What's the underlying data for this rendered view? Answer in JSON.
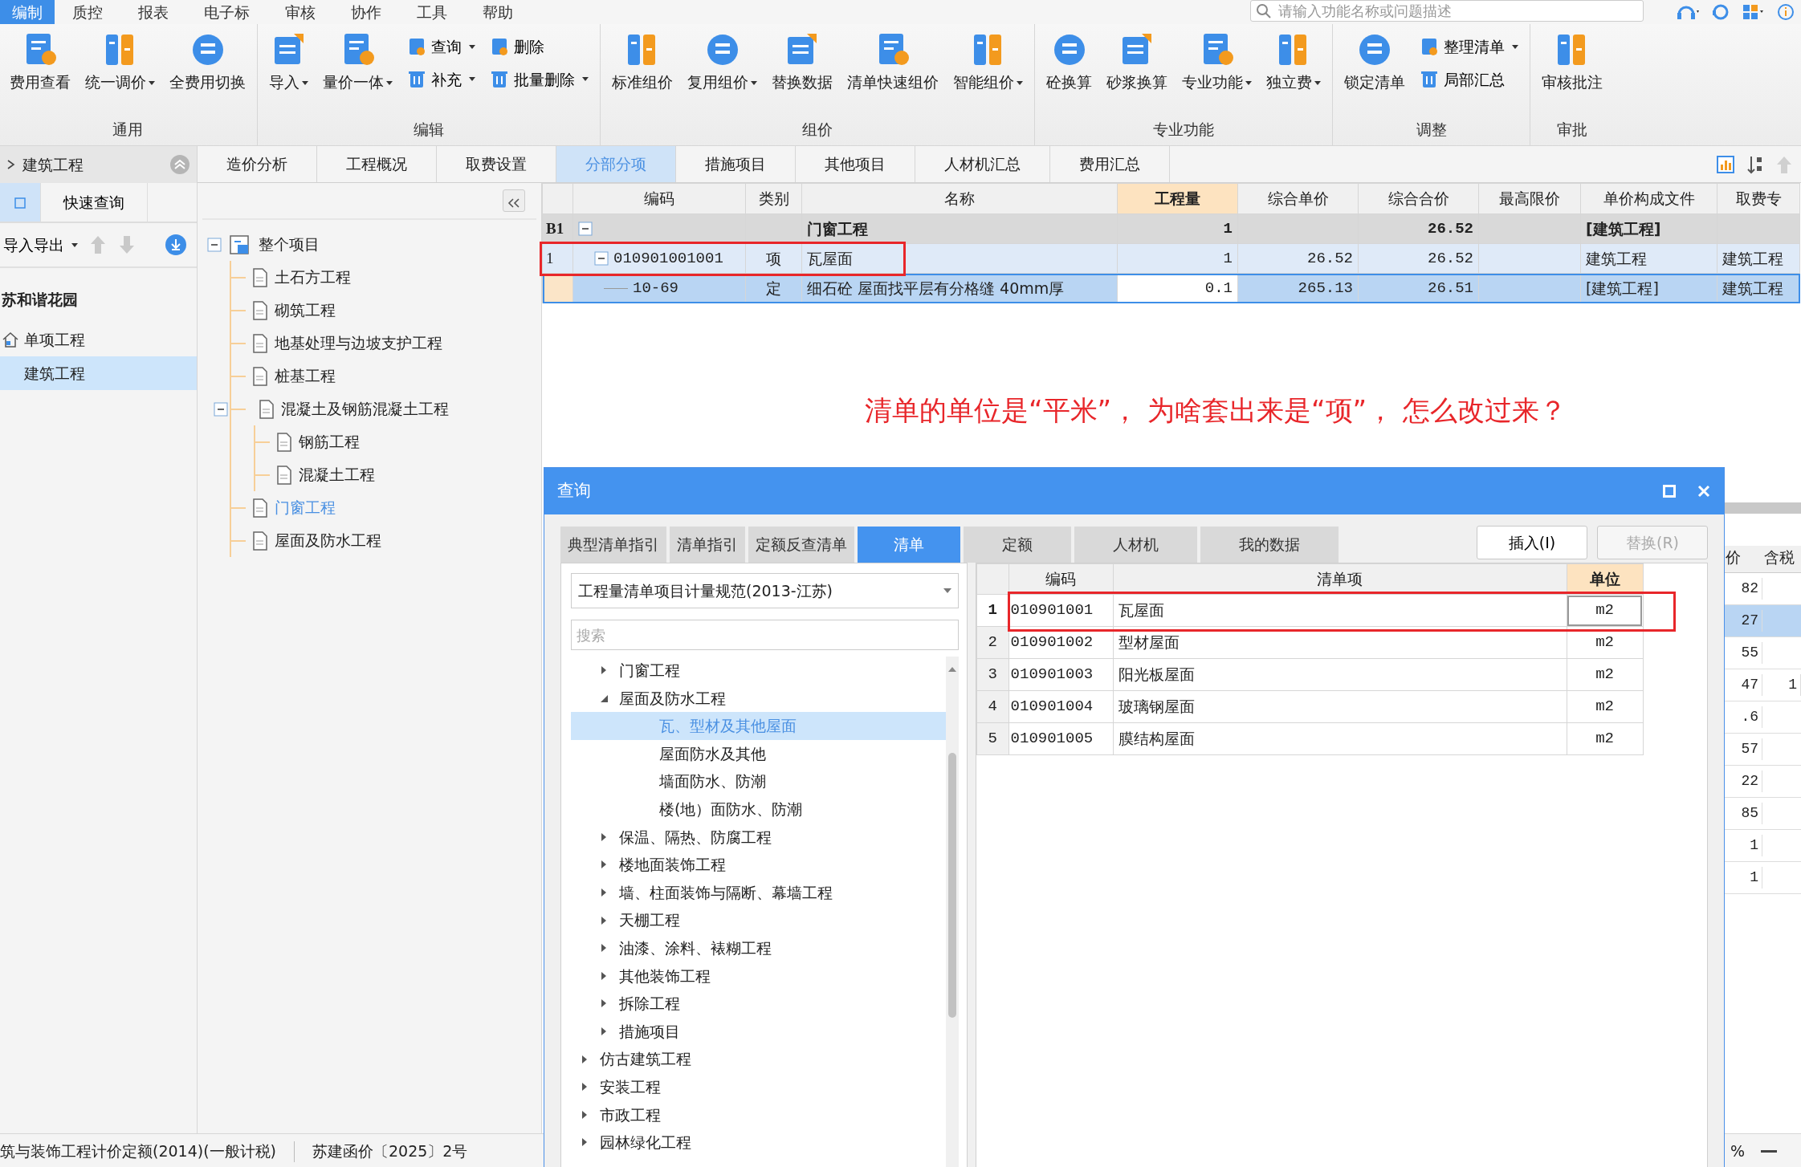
{
  "menu_bar": {
    "items": [
      {
        "label": "编制",
        "selected": true
      },
      {
        "label": "质控",
        "selected": false
      },
      {
        "label": "报表",
        "selected": false
      },
      {
        "label": "电子标",
        "selected": false
      },
      {
        "label": "审核",
        "selected": false
      },
      {
        "label": "协作",
        "selected": false
      },
      {
        "label": "工具",
        "selected": false
      },
      {
        "label": "帮助",
        "selected": false
      }
    ],
    "search": {
      "placeholder": "请输入功能名称或问题描述"
    }
  },
  "ribbon": {
    "groups": [
      {
        "label": "通用",
        "buttons": [
          {
            "label": "费用查看",
            "kind": "large",
            "dropdown": false
          },
          {
            "label": "统一调价",
            "kind": "large",
            "dropdown": true
          },
          {
            "label": "全费用切换",
            "kind": "large",
            "dropdown": false
          }
        ]
      },
      {
        "label": "编辑",
        "buttons": [
          {
            "label": "导入",
            "kind": "large",
            "dropdown": true
          },
          {
            "label": "量价一体",
            "kind": "large",
            "dropdown": true
          },
          {
            "label": "查询",
            "kind": "small",
            "dropdown": true
          },
          {
            "label": "补充",
            "kind": "small",
            "dropdown": true
          },
          {
            "label": "删除",
            "kind": "small",
            "dropdown": false
          },
          {
            "label": "批量删除",
            "kind": "small",
            "dropdown": true
          }
        ]
      },
      {
        "label": "组价",
        "buttons": [
          {
            "label": "标准组价",
            "kind": "large",
            "dropdown": false
          },
          {
            "label": "复用组价",
            "kind": "large",
            "dropdown": true
          },
          {
            "label": "替换数据",
            "kind": "large",
            "dropdown": false
          },
          {
            "label": "清单快速组价",
            "kind": "large",
            "dropdown": false
          },
          {
            "label": "智能组价",
            "kind": "large",
            "dropdown": true
          }
        ]
      },
      {
        "label": "专业功能",
        "buttons": [
          {
            "label": "砼换算",
            "kind": "large",
            "dropdown": false
          },
          {
            "label": "砂浆换算",
            "kind": "large",
            "dropdown": false
          },
          {
            "label": "专业功能",
            "kind": "large",
            "dropdown": true
          },
          {
            "label": "独立费",
            "kind": "large",
            "dropdown": true
          }
        ]
      },
      {
        "label": "调整",
        "buttons": [
          {
            "label": "锁定清单",
            "kind": "large",
            "dropdown": false
          },
          {
            "label": "整理清单",
            "kind": "small",
            "dropdown": true
          },
          {
            "label": "局部汇总",
            "kind": "small",
            "dropdown": false
          }
        ]
      },
      {
        "label": "审批",
        "buttons": [
          {
            "label": "审核批注",
            "kind": "large",
            "dropdown": false
          }
        ]
      }
    ]
  },
  "left_panel": {
    "title": "建筑工程",
    "tabs": [
      {
        "kind": "icon",
        "selected": true
      },
      {
        "kind": "text",
        "label": "快速查询",
        "selected": false
      }
    ],
    "toolbar": {
      "menu": "导入导出",
      "move_up_disabled": true,
      "move_down_disabled": true
    },
    "project": {
      "label": "苏和谐花园",
      "children": [
        {
          "label": "单项工程",
          "selected": false,
          "children": [
            {
              "label": "建筑工程",
              "selected": true
            }
          ]
        }
      ]
    }
  },
  "section_tree": [
    {
      "label": "整个项目",
      "expanded": true,
      "selected": false,
      "children": [
        {
          "label": "土石方工程",
          "selected": false
        },
        {
          "label": "砌筑工程",
          "selected": false
        },
        {
          "label": "地基处理与边坡支护工程",
          "selected": false
        },
        {
          "label": "桩基工程",
          "selected": false
        },
        {
          "label": "混凝土及钢筋混凝土工程",
          "expanded": true,
          "selected": false,
          "children": [
            {
              "label": "钢筋工程",
              "selected": false
            },
            {
              "label": "混凝土工程",
              "selected": false
            }
          ]
        },
        {
          "label": "门窗工程",
          "selected": true
        },
        {
          "label": "屋面及防水工程",
          "selected": false
        }
      ]
    }
  ],
  "main_tabs": [
    {
      "label": "造价分析",
      "selected": false
    },
    {
      "label": "工程概况",
      "selected": false
    },
    {
      "label": "取费设置",
      "selected": false
    },
    {
      "label": "分部分项",
      "selected": true
    },
    {
      "label": "措施项目",
      "selected": false
    },
    {
      "label": "其他项目",
      "selected": false
    },
    {
      "label": "人材机汇总",
      "selected": false
    },
    {
      "label": "费用汇总",
      "selected": false
    }
  ],
  "table": {
    "columns": [
      {
        "label": "编码",
        "highlighted": false
      },
      {
        "label": "类别",
        "highlighted": false
      },
      {
        "label": "名称",
        "highlighted": false
      },
      {
        "label": "工程量",
        "highlighted": true
      },
      {
        "label": "综合单价",
        "highlighted": false
      },
      {
        "label": "综合合价",
        "highlighted": false
      },
      {
        "label": "最高限价",
        "highlighted": false
      },
      {
        "label": "单价构成文件",
        "highlighted": false
      },
      {
        "label": "取费专",
        "highlighted": false
      }
    ],
    "rows": [
      {
        "kind": "division",
        "header": "B1",
        "expanded": true,
        "selected": false,
        "marked": false,
        "cells": [
          "",
          "",
          "门窗工程",
          "1",
          "",
          "26.52",
          "",
          "[建筑工程]",
          ""
        ]
      },
      {
        "kind": "item",
        "header": "1",
        "expanded": true,
        "selected": false,
        "marked": true,
        "cells": [
          "010901001001",
          "项",
          "瓦屋面",
          "1",
          "26.52",
          "26.52",
          "",
          "建筑工程",
          "建筑工程"
        ]
      },
      {
        "kind": "quota",
        "selected": true,
        "marked": false,
        "cells": [
          "10-69",
          "定",
          "细石砼 屋面找平层有分格缝 40mm厚",
          "0.1",
          "265.13",
          "26.51",
          "",
          "[建筑工程]",
          "建筑工程"
        ]
      }
    ]
  },
  "annotation_text": "清单的单位是“平米”， 为啥套出来是“项”， 怎么改过来？",
  "background_grid": {
    "columns": [
      "价",
      "含税"
    ],
    "rows": [
      {
        "cells": [
          "82",
          ""
        ],
        "selected": false
      },
      {
        "cells": [
          "27",
          ""
        ],
        "selected": true
      },
      {
        "cells": [
          "55",
          ""
        ],
        "selected": false
      },
      {
        "cells": [
          "47",
          "1"
        ],
        "selected": false
      },
      {
        "cells": [
          ".6",
          ""
        ],
        "selected": false
      },
      {
        "cells": [
          "57",
          ""
        ],
        "selected": false
      },
      {
        "cells": [
          "22",
          ""
        ],
        "selected": false
      },
      {
        "cells": [
          "85",
          ""
        ],
        "selected": false
      },
      {
        "cells": [
          "1",
          ""
        ],
        "selected": false
      },
      {
        "cells": [
          "1",
          ""
        ],
        "selected": false
      }
    ]
  },
  "dialog": {
    "title": "查询",
    "tabs": [
      {
        "label": "典型清单指引",
        "selected": false
      },
      {
        "label": "清单指引",
        "selected": false
      },
      {
        "label": "定额反查清单",
        "selected": false
      },
      {
        "label": "清单",
        "selected": true
      },
      {
        "label": "定额",
        "selected": false
      },
      {
        "label": "人材机",
        "selected": false
      },
      {
        "label": "我的数据",
        "selected": false
      }
    ],
    "buttons": [
      {
        "label": "插入(I)",
        "disabled": false
      },
      {
        "label": "替换(R)",
        "disabled": true
      }
    ],
    "library": {
      "value": "工程量清单项目计量规范(2013-江苏)"
    },
    "search": {
      "placeholder": "搜索"
    },
    "tree": [
      {
        "children": [
          {
            "label": "门窗工程",
            "expanded": false,
            "selected": false
          },
          {
            "label": "屋面及防水工程",
            "expanded": true,
            "selected": false,
            "children": [
              {
                "label": "瓦、型材及其他屋面",
                "selected": true
              },
              {
                "label": "屋面防水及其他",
                "selected": false
              },
              {
                "label": "墙面防水、防潮",
                "selected": false
              },
              {
                "label": "楼(地）面防水、防潮",
                "selected": false
              }
            ]
          },
          {
            "label": "保温、隔热、防腐工程",
            "expanded": false,
            "selected": false
          },
          {
            "label": "楼地面装饰工程",
            "expanded": false,
            "selected": false
          },
          {
            "label": "墙、柱面装饰与隔断、幕墙工程",
            "expanded": false,
            "selected": false
          },
          {
            "label": "天棚工程",
            "expanded": false,
            "selected": false
          },
          {
            "label": "油漆、涂料、裱糊工程",
            "expanded": false,
            "selected": false
          },
          {
            "label": "其他装饰工程",
            "expanded": false,
            "selected": false
          },
          {
            "label": "拆除工程",
            "expanded": false,
            "selected": false
          },
          {
            "label": "措施项目",
            "expanded": false,
            "selected": false
          }
        ]
      },
      {
        "label": "仿古建筑工程",
        "expanded": false,
        "selected": false
      },
      {
        "label": "安装工程",
        "expanded": false,
        "selected": false
      },
      {
        "label": "市政工程",
        "expanded": false,
        "selected": false
      },
      {
        "label": "园林绿化工程",
        "expanded": false,
        "selected": false
      }
    ],
    "results": {
      "columns": [
        {
          "label": "编码",
          "highlighted": false
        },
        {
          "label": "清单项",
          "highlighted": false
        },
        {
          "label": "单位",
          "highlighted": true
        }
      ],
      "rows": [
        {
          "number": "1",
          "selected": true,
          "marked": true,
          "cells": [
            "010901001",
            "瓦屋面",
            "m2"
          ]
        },
        {
          "number": "2",
          "selected": false,
          "marked": false,
          "cells": [
            "010901002",
            "型材屋面",
            "m2"
          ]
        },
        {
          "number": "3",
          "selected": false,
          "marked": false,
          "cells": [
            "010901003",
            "阳光板屋面",
            "m2"
          ]
        },
        {
          "number": "4",
          "selected": false,
          "marked": false,
          "cells": [
            "010901004",
            "玻璃钢屋面",
            "m2"
          ]
        },
        {
          "number": "5",
          "selected": false,
          "marked": false,
          "cells": [
            "010901005",
            "膜结构屋面",
            "m2"
          ]
        }
      ]
    }
  },
  "status_bar": {
    "items": [
      "筑与装饰工程计价定额(2014)(一般计税)",
      "苏建函价〔2025〕2号"
    ],
    "zoom": "%"
  }
}
